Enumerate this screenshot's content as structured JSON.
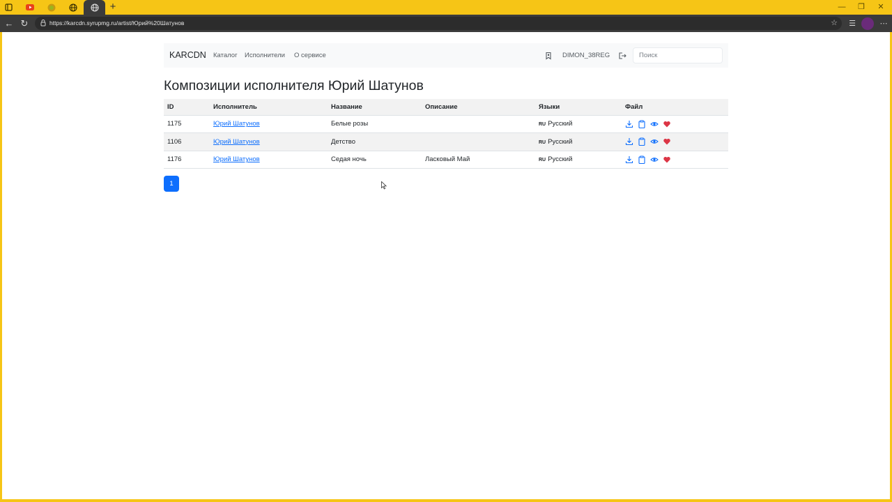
{
  "browser": {
    "url": "https://karcdn.syrupmg.ru/artist/Юрий%20Шатунов",
    "new_tab_label": "+"
  },
  "site": {
    "brand": "KARCDN",
    "nav_links": [
      "Каталог",
      "Исполнители",
      "О сервисе"
    ],
    "username": "DIMON_38REG",
    "search_placeholder": "Поиск"
  },
  "page": {
    "title": "Композиции исполнителя Юрий Шатунов"
  },
  "table": {
    "headers": [
      "ID",
      "Исполнитель",
      "Название",
      "Описание",
      "Языки",
      "Файл"
    ],
    "rows": [
      {
        "id": "1175",
        "artist": "Юрий Шатунов",
        "title": "Белые розы",
        "description": "",
        "lang_code": "RU",
        "language": "Русский"
      },
      {
        "id": "1106",
        "artist": "Юрий Шатунов",
        "title": "Детство",
        "description": "",
        "lang_code": "RU",
        "language": "Русский"
      },
      {
        "id": "1176",
        "artist": "Юрий Шатунов",
        "title": "Седая ночь",
        "description": "Ласковый Май",
        "lang_code": "RU",
        "language": "Русский"
      }
    ]
  },
  "pagination": {
    "current": "1"
  },
  "icons": {
    "action_color": "#0d6efd",
    "heart_color": "#dc3545",
    "names": [
      "download-icon",
      "clipboard-icon",
      "eye-icon",
      "heart-icon"
    ]
  },
  "colors": {
    "browser_frame": "#f6c516",
    "primary": "#0d6efd"
  }
}
